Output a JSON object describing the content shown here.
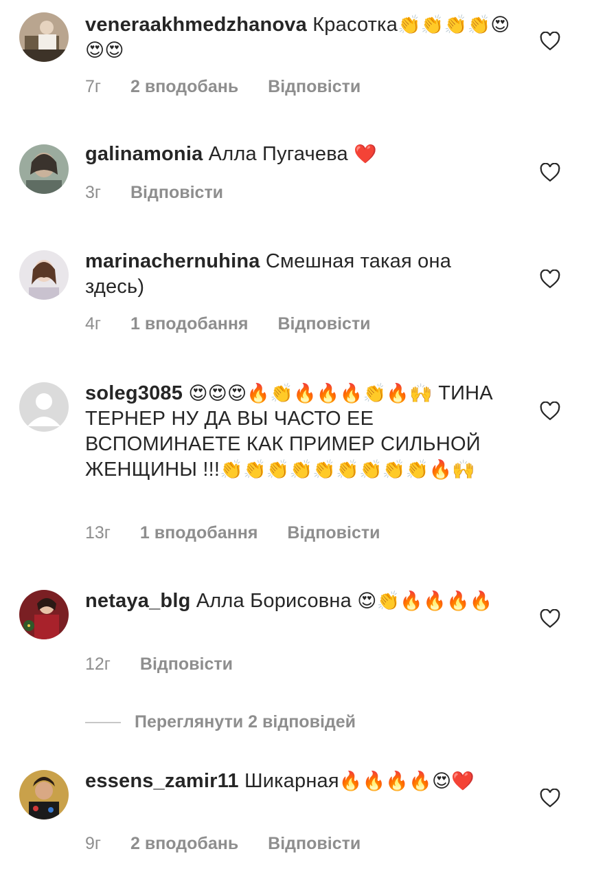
{
  "comments": [
    {
      "username": "veneraakhmedzhanova",
      "text": "Красотка",
      "emoji_after": "👏👏👏👏😍😍😍",
      "time": "7г",
      "likes": "2 вподобань",
      "reply": "Відповісти"
    },
    {
      "username": "galinamonia",
      "text": "Алла Пугачева",
      "emoji_after": "❤️",
      "time": "3г",
      "likes": "",
      "reply": "Відповісти"
    },
    {
      "username": "marinachernuhina",
      "text": "Смешная такая она здесь)",
      "emoji_after": "",
      "time": "4г",
      "likes": "1 вподобання",
      "reply": "Відповісти"
    },
    {
      "username": "soleg3085",
      "text_pre_emoji": "😍😍😍🔥👏🔥🔥🔥👏🔥🙌",
      "text": "ТИНА ТЕРНЕР НУ ДА ВЫ ЧАСТО ЕЕ ВСПОМИНАЕТЕ КАК ПРИМЕР СИЛЬНОЙ ЖЕНЩИНЫ !!!",
      "emoji_after": "👏👏👏👏👏👏👏👏👏🔥🙌",
      "time": "13г",
      "likes": "1 вподобання",
      "reply": "Відповісти"
    },
    {
      "username": "netaya_blg",
      "text": "Алла Борисовна",
      "emoji_after": "😍👏🔥🔥🔥🔥",
      "time": "12г",
      "likes": "",
      "reply": "Відповісти"
    },
    {
      "username": "essens_zamir11",
      "text": "Шикарная",
      "emoji_after": "🔥🔥🔥🔥😍❤️",
      "time": "9г",
      "likes": "2 вподобань",
      "reply": "Відповісти"
    }
  ],
  "view_replies": "Переглянути 2 відповідей",
  "icons": {
    "like": "heart-outline-icon"
  }
}
